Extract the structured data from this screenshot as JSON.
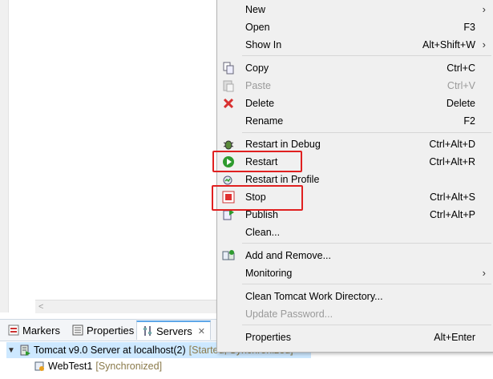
{
  "views": {
    "tabs": [
      {
        "label": "Markers"
      },
      {
        "label": "Properties"
      },
      {
        "label": "Servers",
        "close": "✕"
      }
    ],
    "tree": {
      "server_label": "Tomcat v9.0 Server at localhost(2)",
      "server_state": "[Started, Synchronized]",
      "child_label": "WebTest1",
      "child_state": "[Synchronized]"
    }
  },
  "menu": {
    "new": {
      "label": "New"
    },
    "open": {
      "label": "Open",
      "shortcut": "F3"
    },
    "show_in": {
      "label": "Show In",
      "shortcut": "Alt+Shift+W"
    },
    "copy": {
      "label": "Copy",
      "shortcut": "Ctrl+C"
    },
    "paste": {
      "label": "Paste",
      "shortcut": "Ctrl+V"
    },
    "delete": {
      "label": "Delete",
      "shortcut": "Delete"
    },
    "rename": {
      "label": "Rename",
      "shortcut": "F2"
    },
    "restart_debug": {
      "label": "Restart in Debug",
      "shortcut": "Ctrl+Alt+D"
    },
    "restart": {
      "label": "Restart",
      "shortcut": "Ctrl+Alt+R"
    },
    "restart_profile": {
      "label": "Restart in Profile"
    },
    "stop": {
      "label": "Stop",
      "shortcut": "Ctrl+Alt+S"
    },
    "publish": {
      "label": "Publish",
      "shortcut": "Ctrl+Alt+P"
    },
    "clean": {
      "label": "Clean..."
    },
    "add_remove": {
      "label": "Add and Remove..."
    },
    "monitoring": {
      "label": "Monitoring"
    },
    "clean_work_dir": {
      "label": "Clean Tomcat Work Directory..."
    },
    "update_password": {
      "label": "Update Password..."
    },
    "properties": {
      "label": "Properties",
      "shortcut": "Alt+Enter"
    }
  },
  "colors": {
    "highlight_box": "#e02020",
    "selection": "#cde8ff",
    "restart_icon": "#2e9b2e",
    "stop_icon": "#e03030",
    "delete_icon": "#d83030"
  }
}
